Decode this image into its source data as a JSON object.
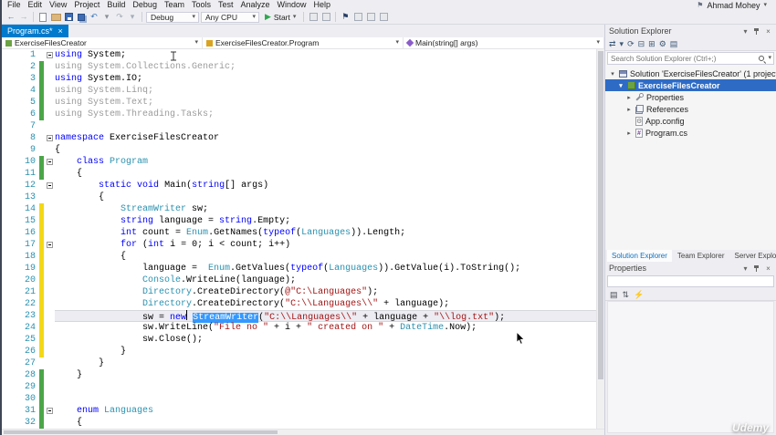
{
  "colors": {
    "accent": "#007ACC",
    "keyword": "#0000FF",
    "type": "#2B91AF",
    "string": "#A31515",
    "unused_code": "#9B9B9B",
    "line_number": "#2B91AF",
    "change_saved": "#4BA648",
    "change_unsaved": "#F2D816",
    "editor_selection": "#3399FF",
    "tree_selection": "#2E6BC5"
  },
  "icons": {
    "dropdown": "▾",
    "close": "×",
    "collapsed": "▸",
    "expanded": "▾",
    "play": "▶",
    "flag": "⚑"
  },
  "menubar": {
    "items": [
      "File",
      "Edit",
      "View",
      "Project",
      "Build",
      "Debug",
      "Team",
      "Tools",
      "Test",
      "Analyze",
      "Window",
      "Help"
    ],
    "user": "Ahmad Mohey"
  },
  "toolbar": {
    "configuration": "Debug",
    "platform": "Any CPU",
    "start_label": "Start",
    "icons_left": [
      {
        "name": "nav-backward-icon",
        "glyph": "←",
        "color": "#3E7BC0"
      },
      {
        "name": "nav-forward-icon",
        "glyph": "→",
        "color": "#A6ADB8"
      },
      {
        "name": "separator"
      },
      {
        "name": "new-file-icon",
        "shape": "page"
      },
      {
        "name": "open-file-icon",
        "shape": "folder"
      },
      {
        "name": "save-icon",
        "shape": "save"
      },
      {
        "name": "save-all-icon",
        "shape": "saveall"
      },
      {
        "name": "undo-icon",
        "glyph": "↶",
        "color": "#3E7BC0"
      },
      {
        "name": "undo-dropdown-icon",
        "glyph": "▾",
        "color": "#8A8F98"
      },
      {
        "name": "redo-icon",
        "glyph": "↷",
        "color": "#A6ADB8"
      },
      {
        "name": "redo-dropdown-icon",
        "glyph": "▾",
        "color": "#A6ADB8"
      },
      {
        "name": "separator"
      }
    ],
    "icons_right": [
      {
        "name": "separator"
      },
      {
        "name": "break-all-icon",
        "shape": "box"
      },
      {
        "name": "stop-icon",
        "shape": "box"
      },
      {
        "name": "separator"
      },
      {
        "name": "bookmark-icon",
        "glyph": "⚑",
        "color": "#273E64"
      },
      {
        "name": "find-in-files-icon",
        "shape": "box"
      },
      {
        "name": "outline-icon",
        "shape": "box"
      },
      {
        "name": "comment-icon",
        "shape": "box"
      }
    ]
  },
  "editor": {
    "tab": {
      "title": "Program.cs*"
    },
    "breadcrumbs": [
      {
        "icon": "project",
        "label": "ExerciseFilesCreator"
      },
      {
        "icon": "class",
        "label": "ExerciseFilesCreator.Program"
      },
      {
        "icon": "method",
        "label": "Main(string[] args)"
      }
    ],
    "lines": [
      {
        "n": 1,
        "f": true,
        "s": [
          [
            "k",
            "using"
          ],
          [
            "p",
            " System;"
          ]
        ]
      },
      {
        "n": 2,
        "m": "g",
        "s": [
          [
            "g",
            "using System.Collections.Generic;"
          ]
        ]
      },
      {
        "n": 3,
        "m": "g",
        "s": [
          [
            "k",
            "using"
          ],
          [
            "p",
            " System.IO;"
          ]
        ]
      },
      {
        "n": 4,
        "m": "g",
        "s": [
          [
            "g",
            "using System.Linq;"
          ]
        ]
      },
      {
        "n": 5,
        "m": "g",
        "s": [
          [
            "g",
            "using System.Text;"
          ]
        ]
      },
      {
        "n": 6,
        "m": "g",
        "s": [
          [
            "g",
            "using System.Threading.Tasks;"
          ]
        ]
      },
      {
        "n": 7,
        "s": []
      },
      {
        "n": 8,
        "f": true,
        "s": [
          [
            "k",
            "namespace"
          ],
          [
            "p",
            " ExerciseFilesCreator"
          ]
        ]
      },
      {
        "n": 9,
        "s": [
          [
            "p",
            "{"
          ]
        ]
      },
      {
        "n": 10,
        "m": "g",
        "f": true,
        "s": [
          [
            "p",
            "    "
          ],
          [
            "k",
            "class"
          ],
          [
            "p",
            " "
          ],
          [
            "t",
            "Program"
          ]
        ]
      },
      {
        "n": 11,
        "m": "g",
        "s": [
          [
            "p",
            "    {"
          ]
        ]
      },
      {
        "n": 12,
        "f": true,
        "s": [
          [
            "p",
            "        "
          ],
          [
            "k",
            "static"
          ],
          [
            "p",
            " "
          ],
          [
            "k",
            "void"
          ],
          [
            "p",
            " Main("
          ],
          [
            "k",
            "string"
          ],
          [
            "p",
            "[] args)"
          ]
        ]
      },
      {
        "n": 13,
        "s": [
          [
            "p",
            "        {"
          ]
        ]
      },
      {
        "n": 14,
        "m": "y",
        "s": [
          [
            "p",
            "            "
          ],
          [
            "t",
            "StreamWriter"
          ],
          [
            "p",
            " sw;"
          ]
        ]
      },
      {
        "n": 15,
        "m": "y",
        "s": [
          [
            "p",
            "            "
          ],
          [
            "k",
            "string"
          ],
          [
            "p",
            " language = "
          ],
          [
            "k",
            "string"
          ],
          [
            "p",
            ".Empty;"
          ]
        ]
      },
      {
        "n": 16,
        "m": "y",
        "s": [
          [
            "p",
            "            "
          ],
          [
            "k",
            "int"
          ],
          [
            "p",
            " count = "
          ],
          [
            "t",
            "Enum"
          ],
          [
            "p",
            ".GetNames("
          ],
          [
            "k",
            "typeof"
          ],
          [
            "p",
            "("
          ],
          [
            "t",
            "Languages"
          ],
          [
            "p",
            ")).Length;"
          ]
        ]
      },
      {
        "n": 17,
        "m": "y",
        "f": true,
        "s": [
          [
            "p",
            "            "
          ],
          [
            "k",
            "for"
          ],
          [
            "p",
            " ("
          ],
          [
            "k",
            "int"
          ],
          [
            "p",
            " i = 0; i < count; i++)"
          ]
        ]
      },
      {
        "n": 18,
        "m": "y",
        "s": [
          [
            "p",
            "            {"
          ]
        ]
      },
      {
        "n": 19,
        "m": "y",
        "s": [
          [
            "p",
            "                language =  "
          ],
          [
            "t",
            "Enum"
          ],
          [
            "p",
            ".GetValues("
          ],
          [
            "k",
            "typeof"
          ],
          [
            "p",
            "("
          ],
          [
            "t",
            "Languages"
          ],
          [
            "p",
            ")).GetValue(i).ToString();"
          ]
        ]
      },
      {
        "n": 20,
        "m": "y",
        "s": [
          [
            "p",
            "                "
          ],
          [
            "t",
            "Console"
          ],
          [
            "p",
            ".WriteLine(language);"
          ]
        ]
      },
      {
        "n": 21,
        "m": "y",
        "s": [
          [
            "p",
            "                "
          ],
          [
            "t",
            "Directory"
          ],
          [
            "p",
            ".CreateDirectory("
          ],
          [
            "s",
            "@\"C:\\Languages\""
          ],
          [
            "p",
            ");"
          ]
        ]
      },
      {
        "n": 22,
        "m": "y",
        "s": [
          [
            "p",
            "                "
          ],
          [
            "t",
            "Directory"
          ],
          [
            "p",
            ".CreateDirectory("
          ],
          [
            "s",
            "\"C:\\\\Languages\\\\\""
          ],
          [
            "p",
            " + language);"
          ]
        ]
      },
      {
        "n": 23,
        "m": "y",
        "active": true,
        "s": [
          [
            "p",
            "                sw = "
          ],
          [
            "k",
            "new"
          ],
          [
            "c",
            ""
          ],
          [
            "p",
            " "
          ],
          [
            "sel",
            "StreamWriter"
          ],
          [
            "p",
            "("
          ],
          [
            "s",
            "\"C:\\\\Languages\\\\\""
          ],
          [
            "p",
            " + language + "
          ],
          [
            "s",
            "\"\\\\log.txt\""
          ],
          [
            "p",
            ");"
          ]
        ]
      },
      {
        "n": 24,
        "m": "y",
        "s": [
          [
            "p",
            "                sw.WriteLine("
          ],
          [
            "s",
            "\"File no \""
          ],
          [
            "p",
            " + i + "
          ],
          [
            "s",
            "\" created on \""
          ],
          [
            "p",
            " + "
          ],
          [
            "t",
            "DateTime"
          ],
          [
            "p",
            ".Now);"
          ]
        ]
      },
      {
        "n": 25,
        "m": "y",
        "s": [
          [
            "p",
            "                sw.Close();"
          ]
        ]
      },
      {
        "n": 26,
        "m": "y",
        "s": [
          [
            "p",
            "            }"
          ]
        ]
      },
      {
        "n": 27,
        "s": [
          [
            "p",
            "        }"
          ]
        ]
      },
      {
        "n": 28,
        "m": "g",
        "s": [
          [
            "p",
            "    }"
          ]
        ]
      },
      {
        "n": 29,
        "m": "g",
        "s": []
      },
      {
        "n": 30,
        "m": "g",
        "s": []
      },
      {
        "n": 31,
        "m": "g",
        "f": true,
        "s": [
          [
            "p",
            "    "
          ],
          [
            "k",
            "enum"
          ],
          [
            "p",
            " "
          ],
          [
            "t",
            "Languages"
          ]
        ]
      },
      {
        "n": 32,
        "m": "g",
        "s": [
          [
            "p",
            "    {"
          ]
        ]
      }
    ]
  },
  "solution_explorer": {
    "title": "Solution Explorer",
    "search_placeholder": "Search Solution Explorer (Ctrl+;)",
    "toolbar_icons": [
      {
        "name": "sync-active-document-icon",
        "glyph": "⇄"
      },
      {
        "name": "filter-dropdown-icon",
        "glyph": "▾"
      },
      {
        "name": "refresh-icon",
        "glyph": "⟳"
      },
      {
        "name": "collapse-all-icon",
        "glyph": "⊟"
      },
      {
        "name": "show-all-files-icon",
        "glyph": "⊞"
      },
      {
        "name": "properties-icon",
        "glyph": "⚙"
      },
      {
        "name": "preview-icon",
        "glyph": "▤"
      }
    ],
    "tree": [
      {
        "icon": "solution",
        "expand": "open",
        "indent": 0,
        "label": "Solution 'ExerciseFilesCreator' (1 project)"
      },
      {
        "icon": "csproject",
        "expand": "open",
        "indent": 1,
        "label": "ExerciseFilesCreator",
        "selected": true
      },
      {
        "icon": "propfolder",
        "expand": "closed",
        "indent": 2,
        "label": "Properties"
      },
      {
        "icon": "references",
        "expand": "closed",
        "indent": 2,
        "label": "References"
      },
      {
        "icon": "config",
        "expand": "none",
        "indent": 2,
        "label": "App.config"
      },
      {
        "icon": "csfile",
        "expand": "closed",
        "indent": 2,
        "label": "Program.cs"
      }
    ]
  },
  "panel_tabs": [
    "Solution Explorer",
    "Team Explorer",
    "Server Explorer"
  ],
  "properties": {
    "title": "Properties",
    "toolbar_icons": [
      {
        "name": "categorized-icon",
        "glyph": "▤"
      },
      {
        "name": "alphabetical-icon",
        "glyph": "⇅"
      },
      {
        "name": "events-icon",
        "glyph": "⚡"
      }
    ]
  },
  "watermark": "Udemy"
}
